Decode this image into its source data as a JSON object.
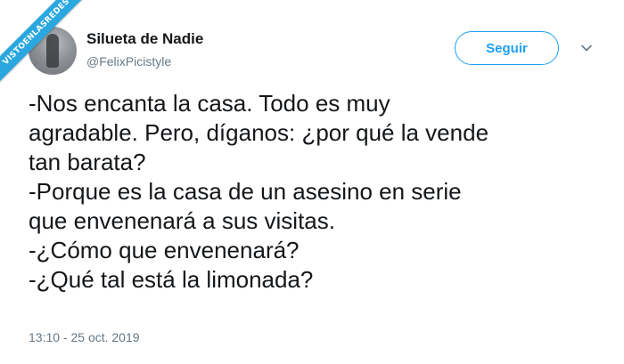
{
  "watermark": {
    "text": "VISTOENLASREDES"
  },
  "header": {
    "avatar_icon": "profile-photo-icon",
    "display_name": "Silueta de Nadie",
    "handle": "@FelixPicistyle",
    "follow_label": "Seguir",
    "menu_icon": "chevron-down-icon"
  },
  "tweet": {
    "lines": [
      "-Nos encanta la casa. Todo es muy",
      "agradable. Pero, díganos: ¿por qué la vende",
      "tan barata?",
      "-Porque es la casa de un asesino en serie",
      "que envenenará a sus visitas.",
      "-¿Cómo que envenenará?",
      "-¿Qué tal está la limonada?"
    ],
    "timestamp": "13:10 - 25 oct. 2019"
  },
  "colors": {
    "accent": "#1da1f2",
    "text_primary": "#14171a",
    "text_secondary": "#657786",
    "watermark": "#2aa7df"
  }
}
